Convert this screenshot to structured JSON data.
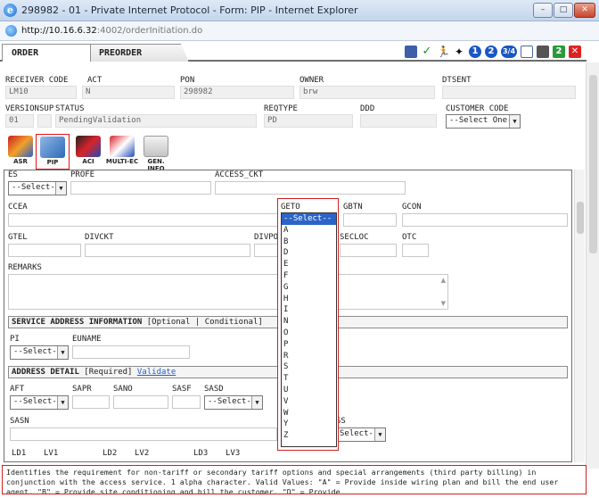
{
  "window": {
    "title": "298982 - 01 - Private Internet Protocol - Form: PIP - Internet Explorer",
    "url_host": "http://10.16.6.32",
    "url_path": ":4002/orderInitiation.do",
    "controls": {
      "minimize": "–",
      "maximize": "□",
      "close": "✕"
    }
  },
  "tabs": [
    {
      "label": "ORDER"
    },
    {
      "label": "PREORDER"
    }
  ],
  "toolbar": {
    "page_one": "1",
    "page_two": "2",
    "page_three_four": "3/4",
    "page_p2": "2"
  },
  "header": {
    "receiver_code": {
      "label": "RECEIVER CODE",
      "value": "LM10"
    },
    "act": {
      "label": "ACT",
      "value": "N"
    },
    "pon": {
      "label": "PON",
      "value": "298982"
    },
    "owner": {
      "label": "OWNER",
      "value": "brw"
    },
    "dtsent": {
      "label": "DTSENT",
      "value": ""
    },
    "version": {
      "label": "VERSION",
      "value": "01"
    },
    "sup": {
      "label": "SUP",
      "value": ""
    },
    "status": {
      "label": "STATUS",
      "value": "PendingValidation"
    },
    "reqtype": {
      "label": "REQTYPE",
      "value": "PD"
    },
    "ddd": {
      "label": "DDD",
      "value": ""
    },
    "customer_code": {
      "label": "CUSTOMER CODE",
      "value": "--Select One--"
    }
  },
  "form_icons": [
    {
      "label": "ASR"
    },
    {
      "label": "PIP"
    },
    {
      "label": "ACI"
    },
    {
      "label": "MULTI-EC"
    },
    {
      "label": "GEN. INFO"
    }
  ],
  "fields": {
    "es": {
      "label": "ES",
      "value": "--Select--"
    },
    "profe": {
      "label": "PROFE"
    },
    "access_ckt": {
      "label": "ACCESS_CKT"
    },
    "ccea": {
      "label": "CCEA"
    },
    "geto": {
      "label": "GETO"
    },
    "gbtn": {
      "label": "GBTN"
    },
    "gcon": {
      "label": "GCON"
    },
    "gtel": {
      "label": "GTEL"
    },
    "divckt": {
      "label": "DIVCKT"
    },
    "divpon": {
      "label": "DIVPON"
    },
    "secloc": {
      "label": "SECLOC"
    },
    "otc": {
      "label": "OTC"
    },
    "remarks": {
      "label": "REMARKS"
    }
  },
  "service_address": {
    "title": "SERVICE ADDRESS INFORMATION",
    "suffix": "[Optional | Conditional]",
    "pi": {
      "label": "PI",
      "value": "--Select--"
    },
    "euname": {
      "label": "EUNAME"
    }
  },
  "address_detail": {
    "title": "ADDRESS DETAIL",
    "required": "[Required]",
    "validate_link": "Validate",
    "aft": {
      "label": "AFT",
      "value": "--Select--"
    },
    "sapr": {
      "label": "SAPR"
    },
    "sano": {
      "label": "SANO"
    },
    "sasf": {
      "label": "SASF"
    },
    "sasd": {
      "label": "SASD",
      "value": "--Select--"
    },
    "sasn": {
      "label": "SASN"
    },
    "ss_partial": {
      "label": "SS",
      "value": "Select--"
    },
    "ld_labels": [
      "LD1",
      "LV1",
      "LD2",
      "LV2",
      "LD3",
      "LV3"
    ]
  },
  "geto_dropdown": {
    "options": [
      "--Select--",
      "A",
      "B",
      "D",
      "E",
      "F",
      "G",
      "H",
      "I",
      "N",
      "O",
      "P",
      "R",
      "S",
      "T",
      "U",
      "V",
      "W",
      "Y",
      "Z"
    ],
    "selected_index": 0
  },
  "help_text": "Identifies the requirement for non-tariff or secondary tariff options and special arrangements (third party billing) in conjunction with the access service. 1 alpha character. Valid Values: \"A\" = Provide inside wiring plan and bill the end user agent, \"B\" = Provide site conditioning and bill the customer, \"D\" = Provide"
}
